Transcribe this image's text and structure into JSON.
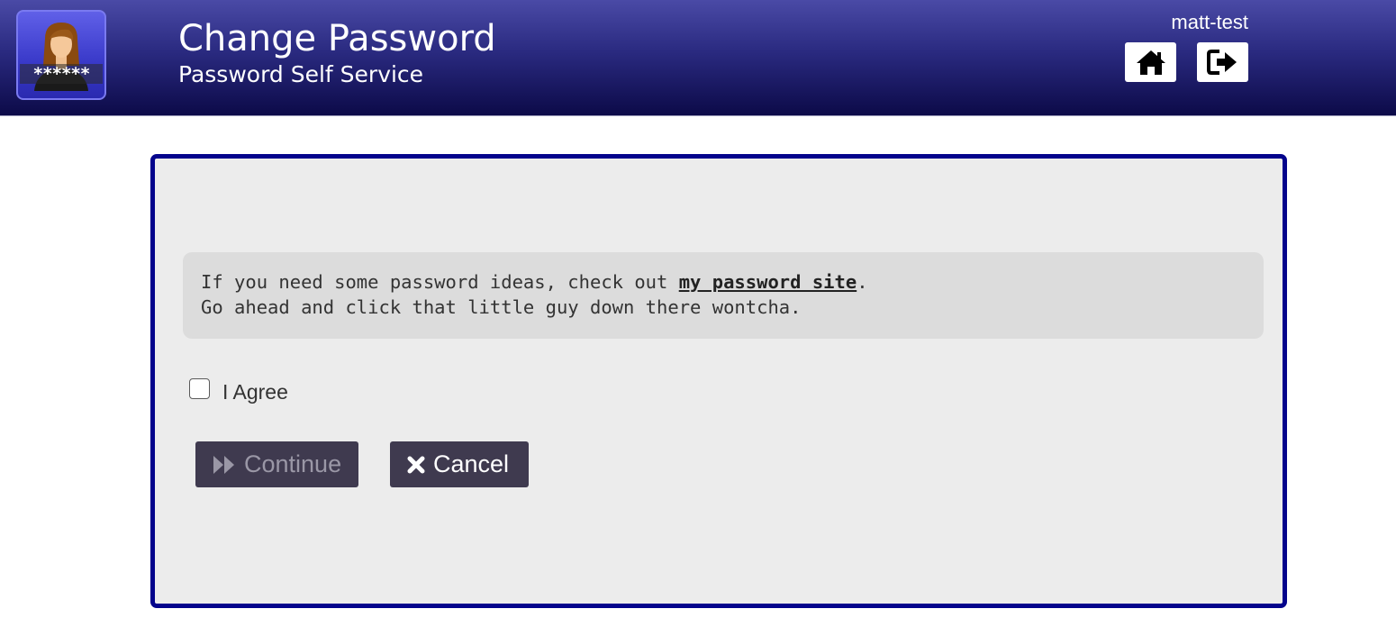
{
  "header": {
    "title": "Change Password",
    "subtitle": "Password Self Service",
    "username": "matt-test",
    "logo_icon": "user-password-logo-icon",
    "logo_text": "******",
    "home_icon": "home-icon",
    "logout_icon": "logout-icon",
    "colors": {
      "bar_top": "#4a4aa6",
      "bar_bottom": "#0c0a48"
    }
  },
  "panel": {
    "message_prefix": "If you need some password ideas, check out ",
    "message_link": "my password site",
    "message_suffix": ".",
    "message_line2": "Go ahead and click that little guy down there wontcha.",
    "agree_label": "I Agree",
    "agree_checked": false,
    "continue_label": "Continue",
    "continue_icon": "fast-forward-icon",
    "continue_enabled": false,
    "cancel_label": "Cancel",
    "cancel_icon": "close-icon",
    "colors": {
      "border": "#04048c",
      "background": "#ececec",
      "button": "#3f3a4f"
    }
  }
}
